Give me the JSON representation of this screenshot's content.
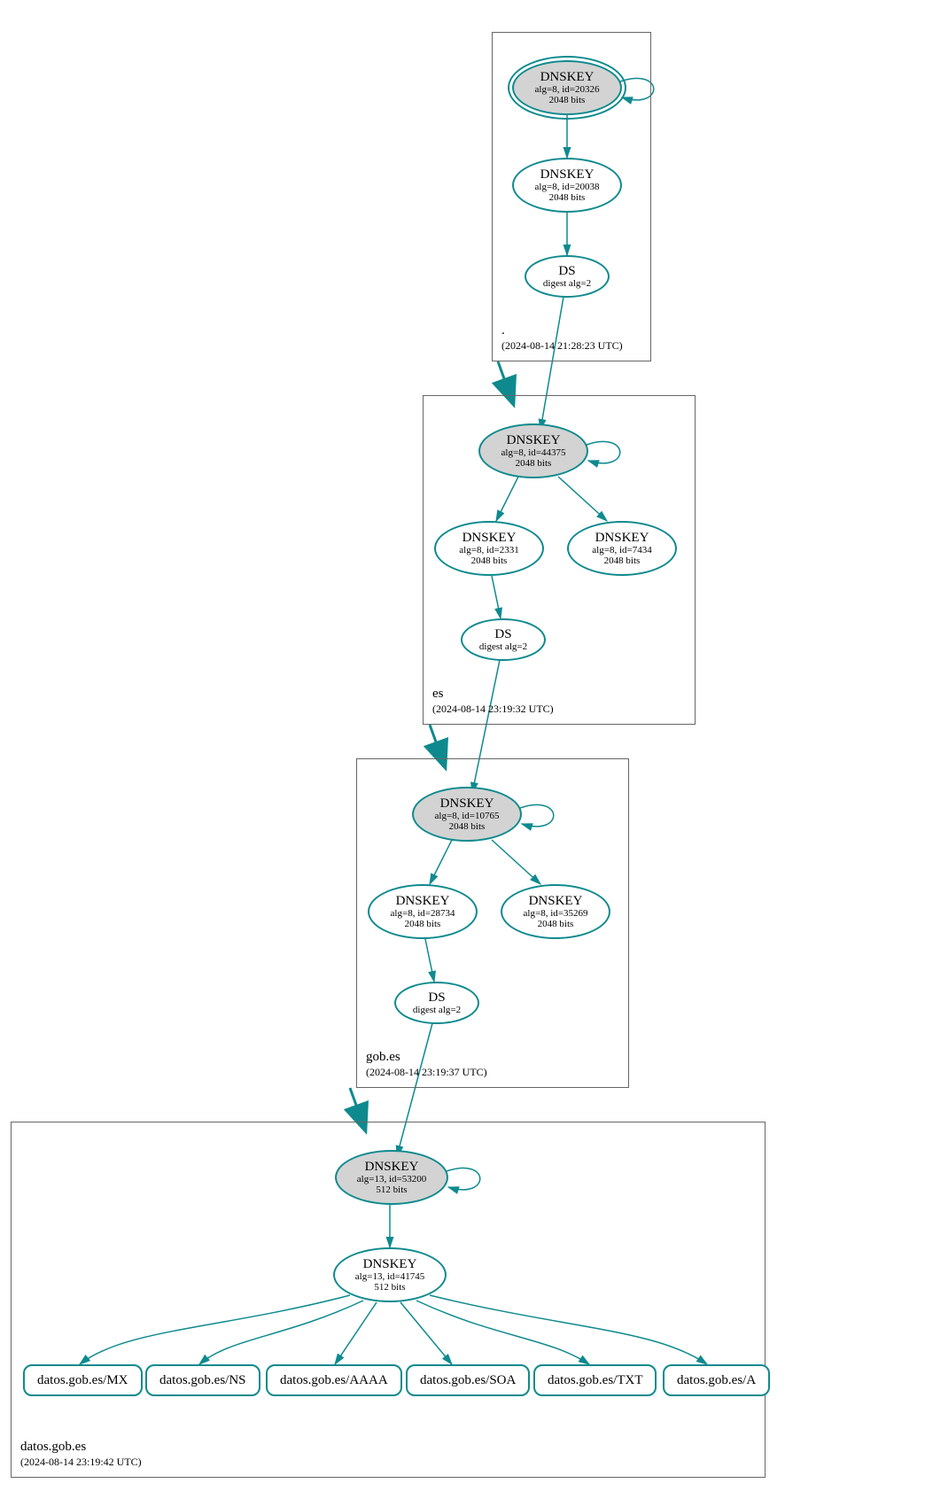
{
  "colors": {
    "stroke": "#0e8a8e",
    "filled": "#d3d3d3"
  },
  "zones": {
    "root": {
      "label": ".",
      "timestamp": "(2024-08-14 21:28:23 UTC)"
    },
    "es": {
      "label": "es",
      "timestamp": "(2024-08-14 23:19:32 UTC)"
    },
    "gobes": {
      "label": "gob.es",
      "timestamp": "(2024-08-14 23:19:37 UTC)"
    },
    "datos": {
      "label": "datos.gob.es",
      "timestamp": "(2024-08-14 23:19:42 UTC)"
    }
  },
  "nodes": {
    "root_ksk": {
      "title": "DNSKEY",
      "sub1": "alg=8, id=20326",
      "sub2": "2048 bits"
    },
    "root_zsk": {
      "title": "DNSKEY",
      "sub1": "alg=8, id=20038",
      "sub2": "2048 bits"
    },
    "root_ds": {
      "title": "DS",
      "sub1": "digest alg=2"
    },
    "es_ksk": {
      "title": "DNSKEY",
      "sub1": "alg=8, id=44375",
      "sub2": "2048 bits"
    },
    "es_zsk1": {
      "title": "DNSKEY",
      "sub1": "alg=8, id=2331",
      "sub2": "2048 bits"
    },
    "es_zsk2": {
      "title": "DNSKEY",
      "sub1": "alg=8, id=7434",
      "sub2": "2048 bits"
    },
    "es_ds": {
      "title": "DS",
      "sub1": "digest alg=2"
    },
    "gob_ksk": {
      "title": "DNSKEY",
      "sub1": "alg=8, id=10765",
      "sub2": "2048 bits"
    },
    "gob_zsk1": {
      "title": "DNSKEY",
      "sub1": "alg=8, id=28734",
      "sub2": "2048 bits"
    },
    "gob_zsk2": {
      "title": "DNSKEY",
      "sub1": "alg=8, id=35269",
      "sub2": "2048 bits"
    },
    "gob_ds": {
      "title": "DS",
      "sub1": "digest alg=2"
    },
    "datos_ksk": {
      "title": "DNSKEY",
      "sub1": "alg=13, id=53200",
      "sub2": "512 bits"
    },
    "datos_zsk": {
      "title": "DNSKEY",
      "sub1": "alg=13, id=41745",
      "sub2": "512 bits"
    },
    "rr_mx": {
      "title": "datos.gob.es/MX"
    },
    "rr_ns": {
      "title": "datos.gob.es/NS"
    },
    "rr_aaaa": {
      "title": "datos.gob.es/AAAA"
    },
    "rr_soa": {
      "title": "datos.gob.es/SOA"
    },
    "rr_txt": {
      "title": "datos.gob.es/TXT"
    },
    "rr_a": {
      "title": "datos.gob.es/A"
    }
  }
}
